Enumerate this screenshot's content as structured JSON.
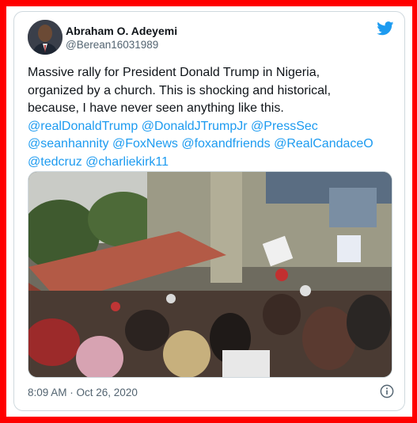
{
  "tweet": {
    "author_name": "Abraham O. Adeyemi",
    "author_handle": "@Berean16031989",
    "text_line1": "Massive rally for President Donald Trump in Nigeria,",
    "text_line2": "organized by a church. This is shocking and historical,",
    "text_line3": "because, I have never seen anything like this.",
    "mentions_line1": "@realDonaldTrump @DonaldJTrumpJr @PressSec",
    "mentions_line2": "@seanhannity @FoxNews @foxandfriends @RealCandaceO",
    "mentions_line3": "@tedcruz @charliekirk11",
    "timestamp": "8:09 AM · Oct 26, 2020"
  },
  "icons": {
    "platform_logo": "twitter-bird-icon",
    "info": "info-icon"
  },
  "colors": {
    "frame": "#ff0000",
    "link": "#1d9bf0",
    "text": "#0f1419",
    "muted": "#536471"
  }
}
